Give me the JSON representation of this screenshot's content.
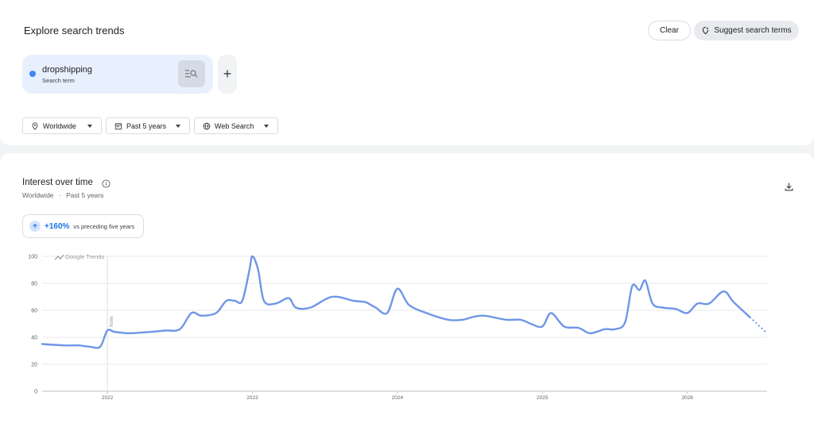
{
  "header": {
    "title": "Explore search trends",
    "clear_label": "Clear",
    "suggest_label": "Suggest search terms"
  },
  "term": {
    "name": "dropshipping",
    "type": "Search term",
    "color": "#4285f4"
  },
  "add_icon": "+",
  "filters": {
    "location": "Worldwide",
    "time": "Past 5 years",
    "property": "Web Search"
  },
  "section": {
    "title": "Interest over time",
    "location": "Worldwide",
    "separator": "·",
    "period": "Past 5 years"
  },
  "change": {
    "value": "+160%",
    "label": "vs preceding five years"
  },
  "chart_data": {
    "type": "line",
    "watermark": "Google Trends",
    "note_label": "Note",
    "ylim": [
      0,
      100
    ],
    "yticks": [
      0,
      20,
      40,
      60,
      80,
      100
    ],
    "xticks": [
      {
        "label": "2022",
        "x": 2022.0
      },
      {
        "label": "2023",
        "x": 2023.0
      },
      {
        "label": "2024",
        "x": 2024.0
      },
      {
        "label": "2025",
        "x": 2025.0
      },
      {
        "label": "2026",
        "x": 2026.0
      }
    ],
    "xlim": [
      2021.55,
      2026.55
    ],
    "note_x": 2022.0,
    "series": [
      {
        "color": "#6f96e6",
        "x": [
          2021.55,
          2021.7,
          2021.8,
          2021.88,
          2021.95,
          2022.0,
          2022.05,
          2022.15,
          2022.3,
          2022.4,
          2022.5,
          2022.58,
          2022.65,
          2022.75,
          2022.82,
          2022.88,
          2022.93,
          2022.98,
          2023.0,
          2023.04,
          2023.08,
          2023.16,
          2023.25,
          2023.3,
          2023.4,
          2023.55,
          2023.7,
          2023.78,
          2023.85,
          2023.93,
          2024.0,
          2024.08,
          2024.2,
          2024.35,
          2024.45,
          2024.52,
          2024.6,
          2024.75,
          2024.85,
          2024.92,
          2025.0,
          2025.06,
          2025.15,
          2025.25,
          2025.33,
          2025.43,
          2025.5,
          2025.57,
          2025.62,
          2025.67,
          2025.71,
          2025.76,
          2025.83,
          2025.92,
          2026.0,
          2026.07,
          2026.15,
          2026.25,
          2026.32,
          2026.43
        ],
        "y": [
          35,
          34,
          34,
          33,
          33,
          45,
          44,
          43,
          44,
          45,
          46,
          58,
          56,
          58,
          67,
          67,
          67,
          90,
          100,
          90,
          67,
          65,
          69,
          62,
          62,
          70,
          67,
          66,
          62,
          58,
          76,
          64,
          58,
          53,
          53,
          55,
          56,
          53,
          53,
          50,
          48,
          58,
          48,
          47,
          43,
          46,
          46,
          51,
          78,
          75,
          82,
          65,
          62,
          61,
          58,
          65,
          65,
          74,
          66,
          55
        ]
      }
    ],
    "partial": {
      "x": [
        2026.43,
        2026.55
      ],
      "y": [
        55,
        43
      ]
    }
  }
}
